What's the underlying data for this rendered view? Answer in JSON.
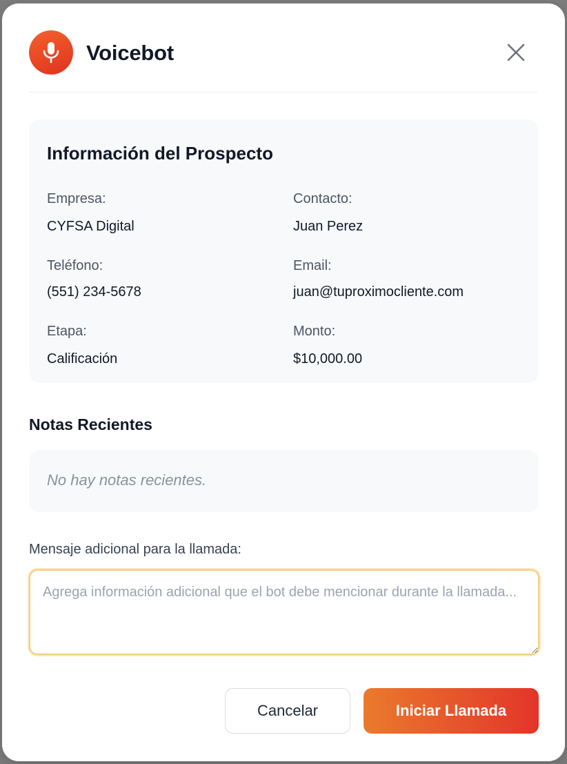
{
  "header": {
    "title": "Voicebot",
    "mic_icon": "microphone-icon",
    "close_icon": "close-icon",
    "accent_color": "#e8462a"
  },
  "prospect": {
    "title": "Información del Prospecto",
    "fields": [
      {
        "label": "Empresa:",
        "value": "CYFSA Digital"
      },
      {
        "label": "Contacto:",
        "value": "Juan Perez"
      },
      {
        "label": "Teléfono:",
        "value": "(551) 234-5678"
      },
      {
        "label": "Email:",
        "value": "juan@tuproximocliente.com"
      },
      {
        "label": "Etapa:",
        "value": "Calificación"
      },
      {
        "label": "Monto:",
        "value": "$10,000.00"
      }
    ]
  },
  "notes": {
    "title": "Notas Recientes",
    "empty_text": "No hay notas recientes."
  },
  "message": {
    "label": "Mensaje adicional para la llamada:",
    "value": "",
    "placeholder": "Agrega información adicional que el bot debe mencionar durante la llamada..."
  },
  "actions": {
    "cancel_label": "Cancelar",
    "start_label": "Iniciar Llamada"
  }
}
